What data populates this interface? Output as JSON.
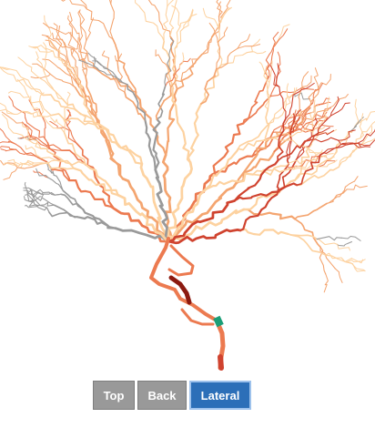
{
  "viewer": {
    "colors": {
      "light": "#fdd2a0",
      "mid": "#f4a570",
      "orange": "#ec7a50",
      "red": "#d0432f",
      "dark": "#8c1a10",
      "gray": "#9a9a9a",
      "green": "#1b9e77"
    }
  },
  "buttons": {
    "top": "Top",
    "back": "Back",
    "lateral": "Lateral",
    "active": "lateral"
  }
}
